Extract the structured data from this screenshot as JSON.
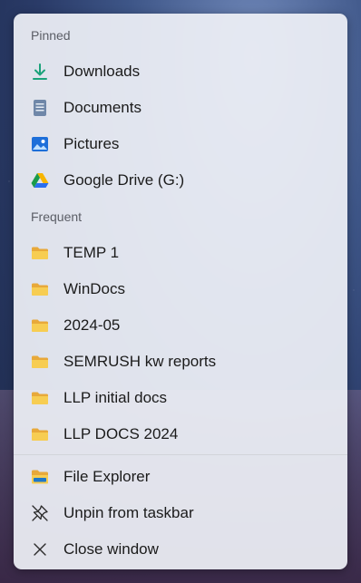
{
  "pinned": {
    "header": "Pinned",
    "items": [
      {
        "label": "Downloads",
        "icon": "download-icon"
      },
      {
        "label": "Documents",
        "icon": "document-icon"
      },
      {
        "label": "Pictures",
        "icon": "pictures-icon"
      },
      {
        "label": "Google Drive (G:)",
        "icon": "google-drive-icon"
      }
    ]
  },
  "frequent": {
    "header": "Frequent",
    "items": [
      {
        "label": "TEMP 1",
        "icon": "folder-icon"
      },
      {
        "label": "WinDocs",
        "icon": "folder-icon"
      },
      {
        "label": "2024-05",
        "icon": "folder-icon"
      },
      {
        "label": "SEMRUSH kw reports",
        "icon": "folder-icon"
      },
      {
        "label": "LLP initial docs",
        "icon": "folder-icon"
      },
      {
        "label": "LLP DOCS 2024",
        "icon": "folder-icon"
      }
    ]
  },
  "actions": [
    {
      "label": "File Explorer",
      "icon": "file-explorer-icon"
    },
    {
      "label": "Unpin from taskbar",
      "icon": "unpin-icon"
    },
    {
      "label": "Close window",
      "icon": "close-icon"
    }
  ],
  "colors": {
    "download_accent": "#1ba27a",
    "folder_yellow": "#f7c948",
    "pictures_blue": "#1e6fd9"
  }
}
